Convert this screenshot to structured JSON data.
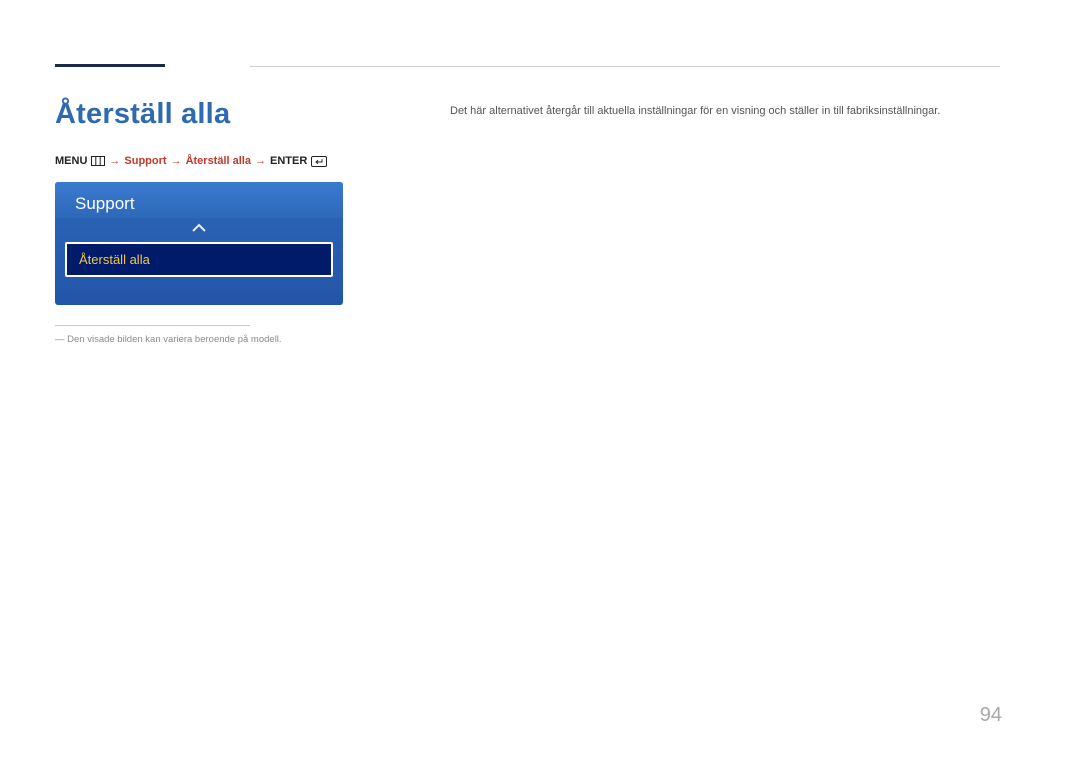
{
  "title": "Återställ alla",
  "breadcrumb": {
    "menu_label": "MENU",
    "path_middle": "Support",
    "path_middle2": "Återställ alla",
    "enter_label": "ENTER"
  },
  "menu_panel": {
    "header": "Support",
    "selected_item": "Återställ alla"
  },
  "footnote": "―  Den visade bilden kan variera beroende på modell.",
  "body_text": "Det här alternativet återgår till aktuella inställningar för en visning och ställer in till fabriksinställningar.",
  "page_number": "94"
}
